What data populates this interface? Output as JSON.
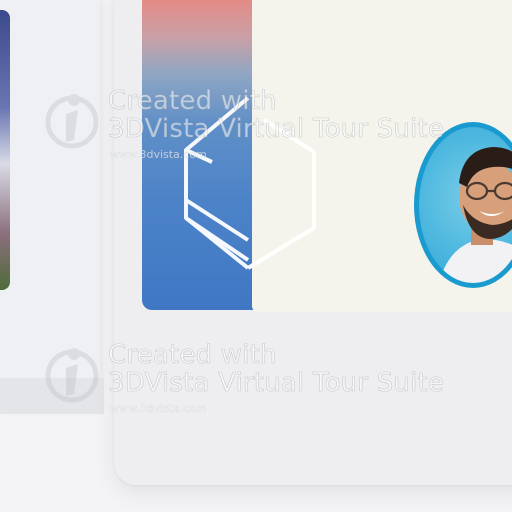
{
  "watermark": {
    "line1": "Created with",
    "line2": "3DVista Virtual Tour Suite",
    "url": "www.3dvista.com"
  },
  "colors": {
    "accent": "#1a9bd0",
    "gradient_top": "#e48b86",
    "gradient_bottom": "#3f77c4",
    "content_panel": "#f5f4ec"
  },
  "icons": {
    "logo": "hexagon-logo-icon",
    "watermark": "3dvista-logo-icon"
  }
}
